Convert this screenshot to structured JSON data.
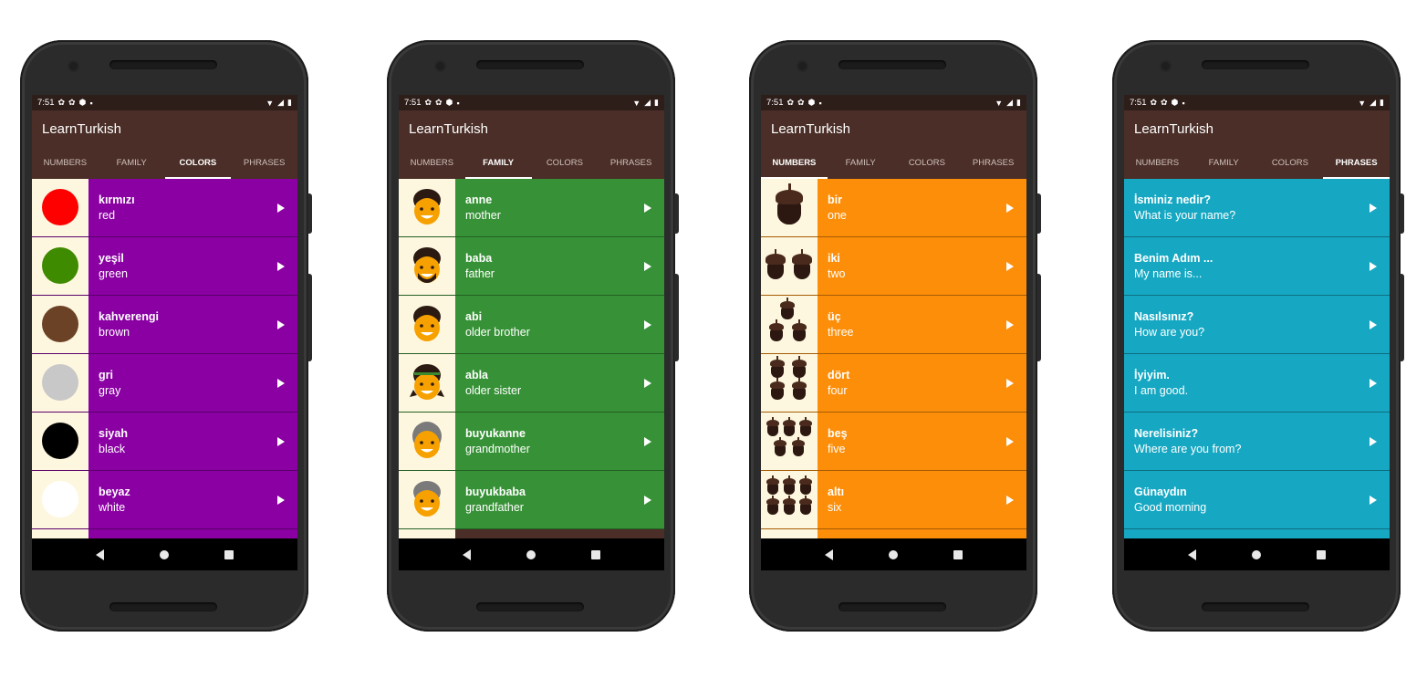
{
  "status_bar": {
    "time": "7:51"
  },
  "app_title": "LearnTurkish",
  "tabs": [
    "NUMBERS",
    "FAMILY",
    "COLORS",
    "PHRASES"
  ],
  "screens": [
    {
      "id": "colors",
      "active_tab": "COLORS",
      "list_color": "#8a00a3",
      "items": [
        {
          "turkish": "kırmızı",
          "english": "red",
          "swatch": "#ff0000"
        },
        {
          "turkish": "yeşil",
          "english": "green",
          "swatch": "#3f8b00"
        },
        {
          "turkish": "kahverengi",
          "english": "brown",
          "swatch": "#6b4226"
        },
        {
          "turkish": "gri",
          "english": "gray",
          "swatch": "#c8c8c8"
        },
        {
          "turkish": "siyah",
          "english": "black",
          "swatch": "#000000"
        },
        {
          "turkish": "beyaz",
          "english": "white",
          "swatch": "#ffffff"
        }
      ]
    },
    {
      "id": "family",
      "active_tab": "FAMILY",
      "list_color": "#379237",
      "items": [
        {
          "turkish": "anne",
          "english": "mother",
          "icon": "mother-icon"
        },
        {
          "turkish": "baba",
          "english": "father",
          "icon": "father-icon"
        },
        {
          "turkish": "abi",
          "english": "older brother",
          "icon": "older-brother-icon"
        },
        {
          "turkish": "abla",
          "english": "older sister",
          "icon": "older-sister-icon"
        },
        {
          "turkish": "buyukanne",
          "english": "grandmother",
          "icon": "grandmother-icon"
        },
        {
          "turkish": "buyukbaba",
          "english": "grandfather",
          "icon": "grandfather-icon"
        }
      ]
    },
    {
      "id": "numbers",
      "active_tab": "NUMBERS",
      "list_color": "#fd8e09",
      "items": [
        {
          "turkish": "bir",
          "english": "one",
          "count": 1
        },
        {
          "turkish": "iki",
          "english": "two",
          "count": 2
        },
        {
          "turkish": "üç",
          "english": "three",
          "count": 3
        },
        {
          "turkish": "dört",
          "english": "four",
          "count": 4
        },
        {
          "turkish": "beş",
          "english": "five",
          "count": 5
        },
        {
          "turkish": "altı",
          "english": "six",
          "count": 6
        }
      ]
    },
    {
      "id": "phrases",
      "active_tab": "PHRASES",
      "list_color": "#16a8c3",
      "items": [
        {
          "turkish": "İsminiz nedir?",
          "english": "What is your name?"
        },
        {
          "turkish": "Benim Adım ...",
          "english": "My name is..."
        },
        {
          "turkish": "Nasılsınız?",
          "english": "How are you?"
        },
        {
          "turkish": "İyiyim.",
          "english": "I am good."
        },
        {
          "turkish": "Nerelisiniz?",
          "english": "Where are you from?"
        },
        {
          "turkish": "Günaydın",
          "english": "Good morning"
        }
      ]
    }
  ]
}
